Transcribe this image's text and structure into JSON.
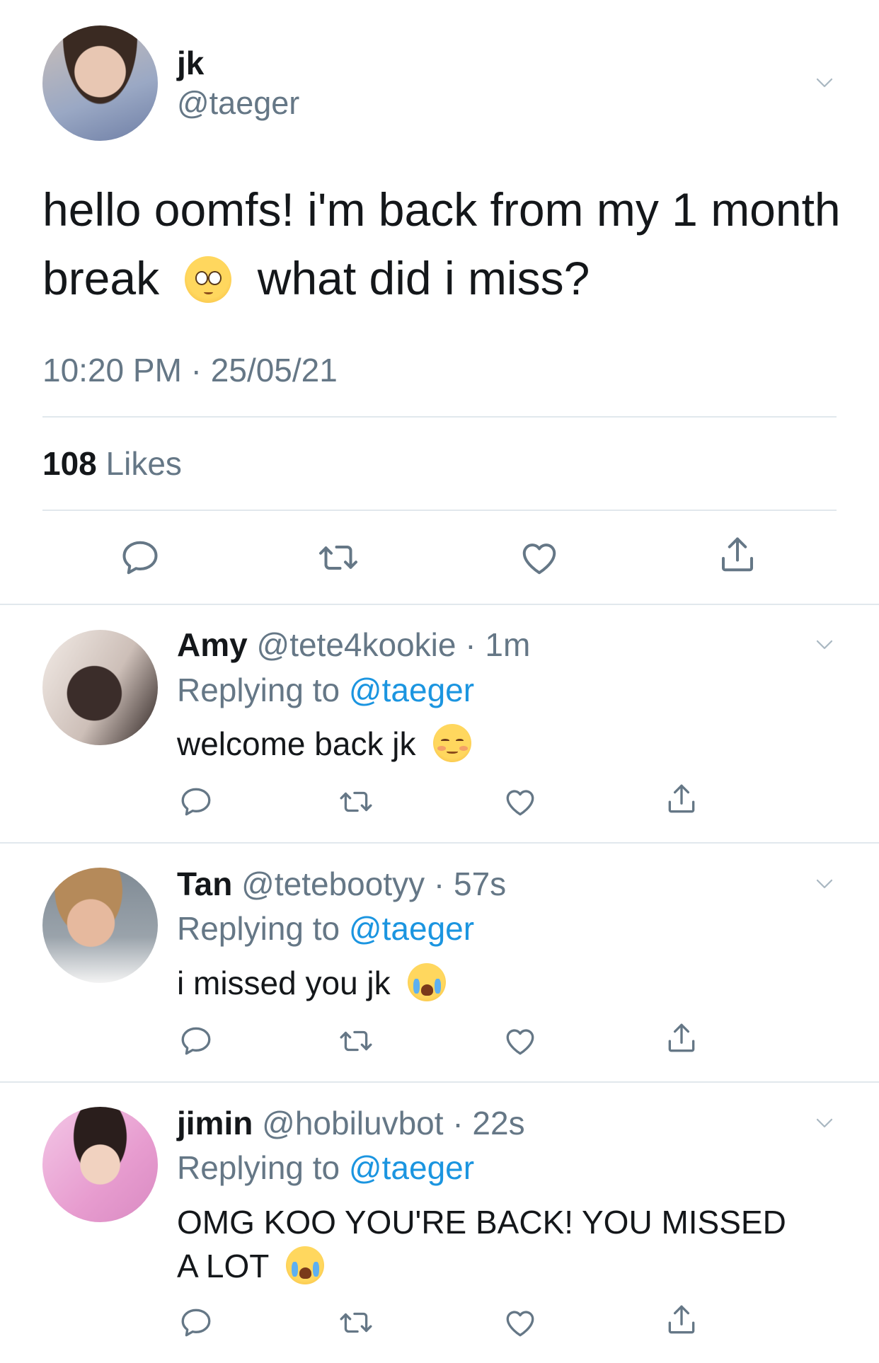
{
  "main_tweet": {
    "name": "jk",
    "handle": "@taeger",
    "text_line1": "hello oomfs! i'm back from my 1 month",
    "text_line2_a": "break",
    "text_line2_b": "what did i miss?",
    "emoji": "pleading-face",
    "timestamp": "10:20 PM · 25/05/21",
    "likes_count": "108",
    "likes_label": "Likes"
  },
  "replies": [
    {
      "name": "Amy",
      "handle": "@tete4kookie",
      "time": "· 1m",
      "replying_prefix": "Replying to",
      "replying_mention": "@taeger",
      "text": "welcome back jk",
      "emoji": "smiling-face"
    },
    {
      "name": "Tan",
      "handle": "@tetebootyy",
      "time": "· 57s",
      "replying_prefix": "Replying to",
      "replying_mention": "@taeger",
      "text": "i missed you jk",
      "emoji": "loudly-crying-face"
    },
    {
      "name": "jimin",
      "handle": "@hobiluvbot",
      "time": "· 22s",
      "replying_prefix": "Replying to",
      "replying_mention": "@taeger",
      "text_line1": "OMG KOO YOU'RE BACK! YOU MISSED",
      "text_line2": "A LOT",
      "emoji": "loudly-crying-face"
    }
  ],
  "icons": [
    "chevron-down-icon",
    "reply-icon",
    "retweet-icon",
    "like-icon",
    "share-icon"
  ],
  "colors": {
    "text": "#14171a",
    "secondary": "#657786",
    "link": "#1b95e0",
    "divider": "#e1e8ed"
  }
}
